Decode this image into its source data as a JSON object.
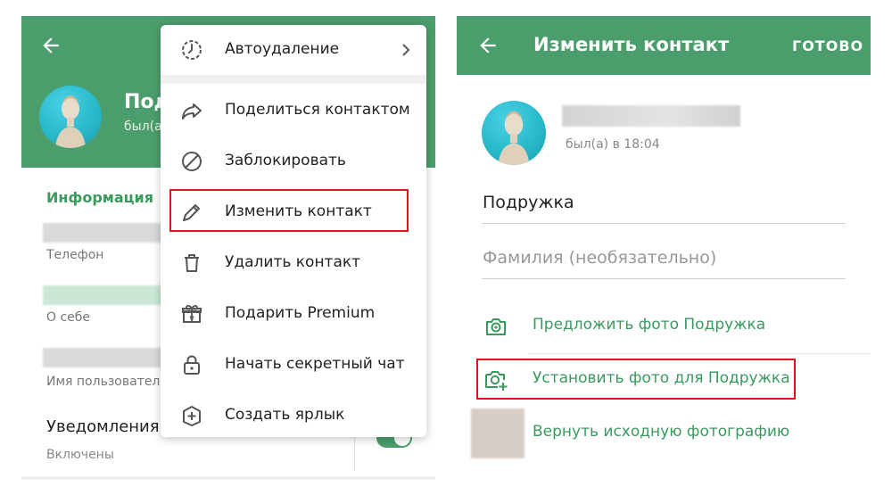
{
  "left_panel": {
    "contact_name_partial": "Под",
    "status_partial": "был(а",
    "info_title": "Информация",
    "phone_label": "Телефон",
    "about_label": "О себе",
    "username_label": "Имя пользователя",
    "notifications_title": "Уведомления",
    "notifications_status": "Включены"
  },
  "menu": {
    "items": [
      {
        "label": "Автоудаление",
        "icon": "auto-delete-icon"
      },
      {
        "label": "Поделиться контактом",
        "icon": "share-icon"
      },
      {
        "label": "Заблокировать",
        "icon": "block-icon"
      },
      {
        "label": "Изменить контакт",
        "icon": "pencil-icon"
      },
      {
        "label": "Удалить контакт",
        "icon": "trash-icon"
      },
      {
        "label": "Подарить Premium",
        "icon": "gift-icon"
      },
      {
        "label": "Начать секретный чат",
        "icon": "lock-icon"
      },
      {
        "label": "Создать ярлык",
        "icon": "add-shortcut-icon"
      }
    ]
  },
  "right_panel": {
    "title": "Изменить контакт",
    "done_label": "ГОТОВО",
    "status": "был(а) в 18:04",
    "first_name": "Подружка",
    "last_name_placeholder": "Фамилия (необязательно)",
    "actions": [
      {
        "label": "Предложить фото Подружка",
        "icon": "suggest-photo-icon"
      },
      {
        "label": "Установить фото для Подружка",
        "icon": "set-photo-icon"
      },
      {
        "label": "Вернуть исходную фотографию",
        "icon": "original-photo-thumbnail"
      }
    ]
  },
  "colors": {
    "header_green": "#4b9e6c",
    "accent_green": "#3a9a5e",
    "highlight_red": "#e1141c"
  }
}
